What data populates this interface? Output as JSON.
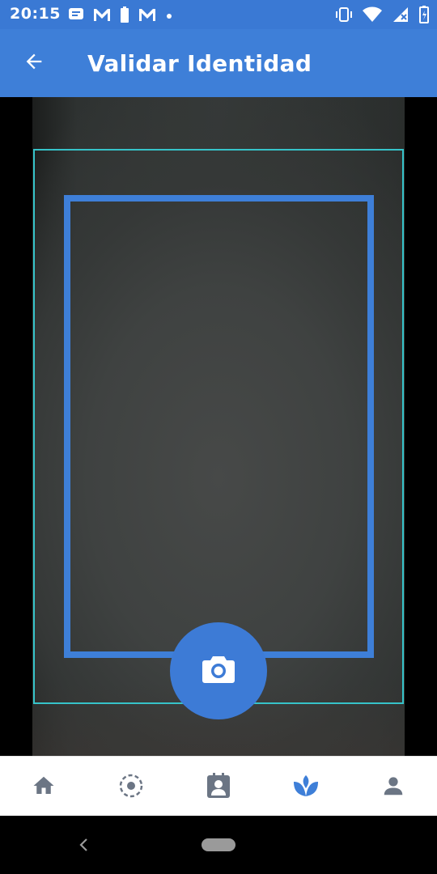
{
  "status_bar": {
    "time": "20:15",
    "notification_icons": [
      "message-icon",
      "gmail-icon",
      "battery-icon",
      "gmail-icon",
      "dot-icon"
    ],
    "right_icons": [
      "vibrate-icon",
      "wifi-icon",
      "signal-icon",
      "battery-icon"
    ]
  },
  "app_bar": {
    "title": "Validar Identidad",
    "back_icon": "arrow-left-icon"
  },
  "camera": {
    "capture_icon": "camera-icon"
  },
  "bottom_nav": {
    "items": [
      {
        "icon": "home-icon",
        "active": false
      },
      {
        "icon": "target-icon",
        "active": false
      },
      {
        "icon": "contact-card-icon",
        "active": false
      },
      {
        "icon": "lotus-icon",
        "active": true
      },
      {
        "icon": "person-icon",
        "active": false
      }
    ]
  },
  "colors": {
    "primary": "#3e7fd8",
    "status_bar": "#3a79d4",
    "outer_guide": "#36c3c9",
    "nav_inactive": "#6b7584",
    "nav_active": "#3e7fd8"
  }
}
